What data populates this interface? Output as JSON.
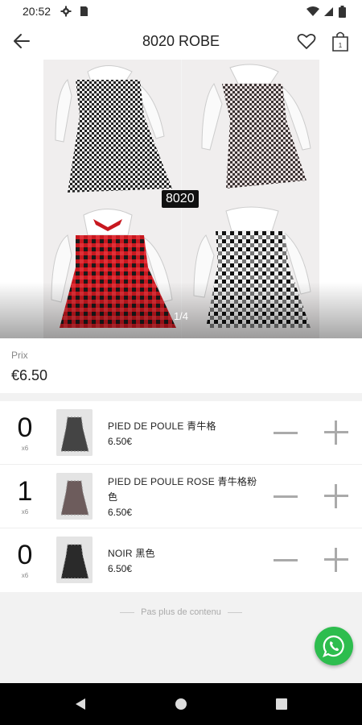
{
  "status_bar": {
    "time": "20:52"
  },
  "header": {
    "title": "8020 ROBE"
  },
  "gallery": {
    "code_label": "8020",
    "pager": "1/4"
  },
  "price": {
    "label": "Prix",
    "value": "€6.50"
  },
  "variants": [
    {
      "qty": "0",
      "unit": "x6",
      "name": "PIED DE POULE 青牛格",
      "price": "6.50€",
      "color": "#3a3a3a"
    },
    {
      "qty": "1",
      "unit": "x6",
      "name": "PIED DE POULE ROSE 青牛格粉色",
      "price": "6.50€",
      "color": "#6d5c5c"
    },
    {
      "qty": "0",
      "unit": "x6",
      "name": "NOIR 黑色",
      "price": "6.50€",
      "color": "#2a2a2a"
    }
  ],
  "footer": {
    "end_note": "Pas plus de contenu"
  },
  "colors": {
    "whatsapp": "#2dbd4e",
    "accent_red": "#c8181f"
  }
}
